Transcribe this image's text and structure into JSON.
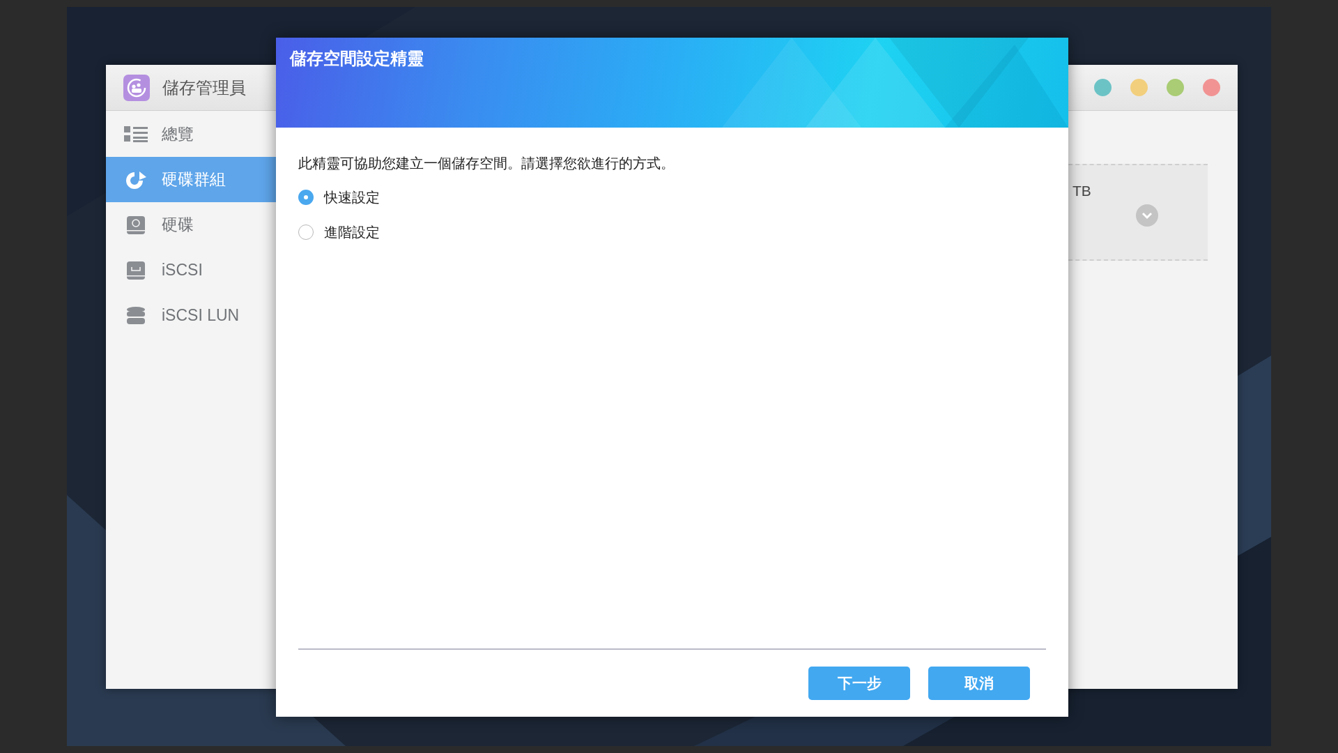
{
  "app": {
    "title": "儲存管理員",
    "sidebar": {
      "items": [
        {
          "label": "總覽",
          "selected": false
        },
        {
          "label": "硬碟群組",
          "selected": true
        },
        {
          "label": "硬碟",
          "selected": false
        },
        {
          "label": "iSCSI",
          "selected": false
        },
        {
          "label": "iSCSI LUN",
          "selected": false
        }
      ]
    },
    "window_controls": [
      {
        "color": "#6cc3c6"
      },
      {
        "color": "#f2cf7d"
      },
      {
        "color": "#a9cc74"
      },
      {
        "color": "#f29393"
      }
    ],
    "content": {
      "card_text": "TB"
    }
  },
  "dialog": {
    "title": "儲存空間設定精靈",
    "message": "此精靈可協助您建立一個儲存空間。請選擇您欲進行的方式。",
    "options": [
      {
        "label": "快速設定",
        "selected": true
      },
      {
        "label": "進階設定",
        "selected": false
      }
    ],
    "buttons": [
      {
        "label": "下一步"
      },
      {
        "label": "取消"
      }
    ]
  }
}
